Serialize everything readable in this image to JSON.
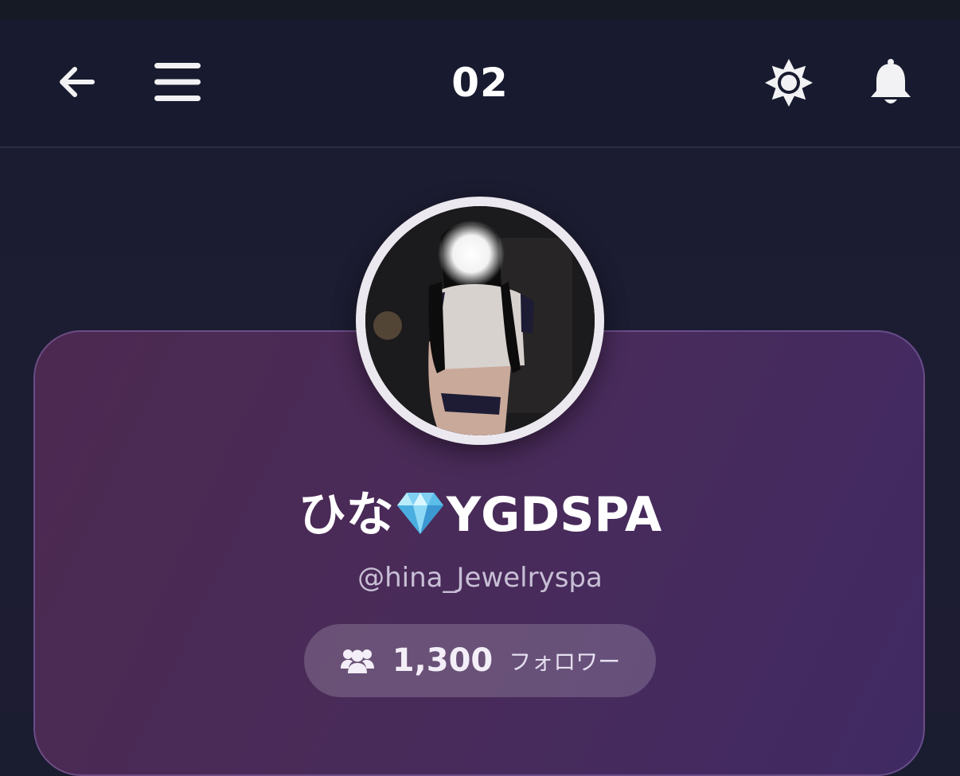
{
  "header": {
    "title": "02",
    "back_icon": "arrow-left-icon",
    "menu_icon": "hamburger-menu-icon",
    "settings_icon": "sun-settings-icon",
    "notifications_icon": "bell-icon"
  },
  "profile": {
    "name_prefix": "ひな",
    "name_icon": "gem-icon",
    "name_suffix": "YGDSPA",
    "handle": "@hina_Jewelryspa",
    "followers": {
      "icon": "users-icon",
      "count": "1,300",
      "label": "フォロワー"
    }
  },
  "colors": {
    "header_bg": "#181b2f",
    "card_gradient_start": "#4c2950",
    "card_gradient_end": "#402a63",
    "avatar_ring": "#ece8ef"
  }
}
